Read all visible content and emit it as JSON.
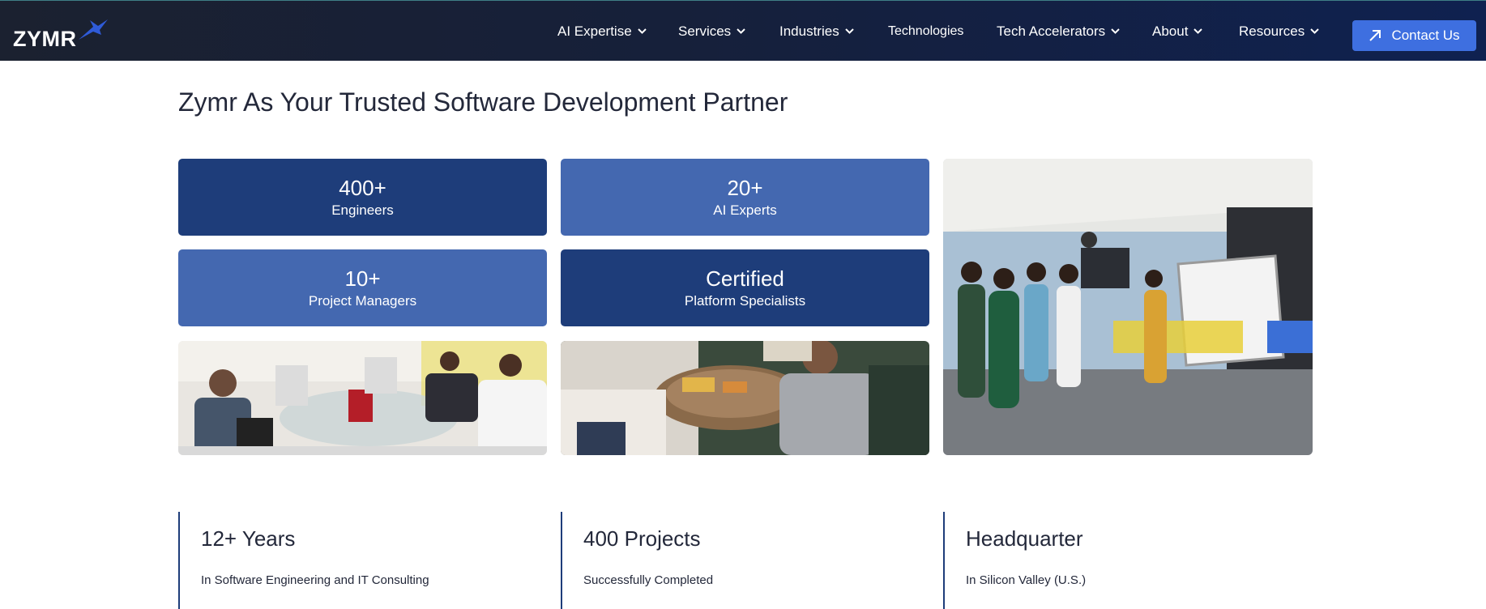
{
  "brand": {
    "logo_text": "ZYMR"
  },
  "nav": {
    "items": [
      {
        "label": "AI Expertise",
        "has_dropdown": true
      },
      {
        "label": "Services",
        "has_dropdown": true
      },
      {
        "label": "Industries",
        "has_dropdown": true
      },
      {
        "label": "Technologies",
        "has_dropdown": false
      },
      {
        "label": "Tech Accelerators",
        "has_dropdown": true
      },
      {
        "label": "About",
        "has_dropdown": true
      },
      {
        "label": "Resources",
        "has_dropdown": true
      }
    ],
    "contact_label": "Contact Us"
  },
  "section": {
    "title": "Zymr As Your Trusted Software Development Partner",
    "stats": [
      {
        "value": "400+",
        "label": "Engineers"
      },
      {
        "value": "20+",
        "label": "AI Experts"
      },
      {
        "value": "10+",
        "label": "Project Managers"
      },
      {
        "value": "Certified",
        "label": "Platform Specialists"
      }
    ],
    "highlights": [
      {
        "title": "12+ Years",
        "subtitle": "In Software Engineering and IT Consulting"
      },
      {
        "title": "400 Projects",
        "subtitle": "Successfully Completed"
      },
      {
        "title": "Headquarter",
        "subtitle": "In Silicon Valley (U.S.)"
      }
    ]
  },
  "colors": {
    "nav_bg": "#16203a",
    "accent_button": "#3e6fe0",
    "card_dark": "#1e3d7a",
    "card_light": "#4468b0"
  },
  "icons": {
    "dropdown": "chevron-down-icon",
    "contact": "arrow-up-right-icon",
    "logo_mark": "bird-logo-icon"
  }
}
